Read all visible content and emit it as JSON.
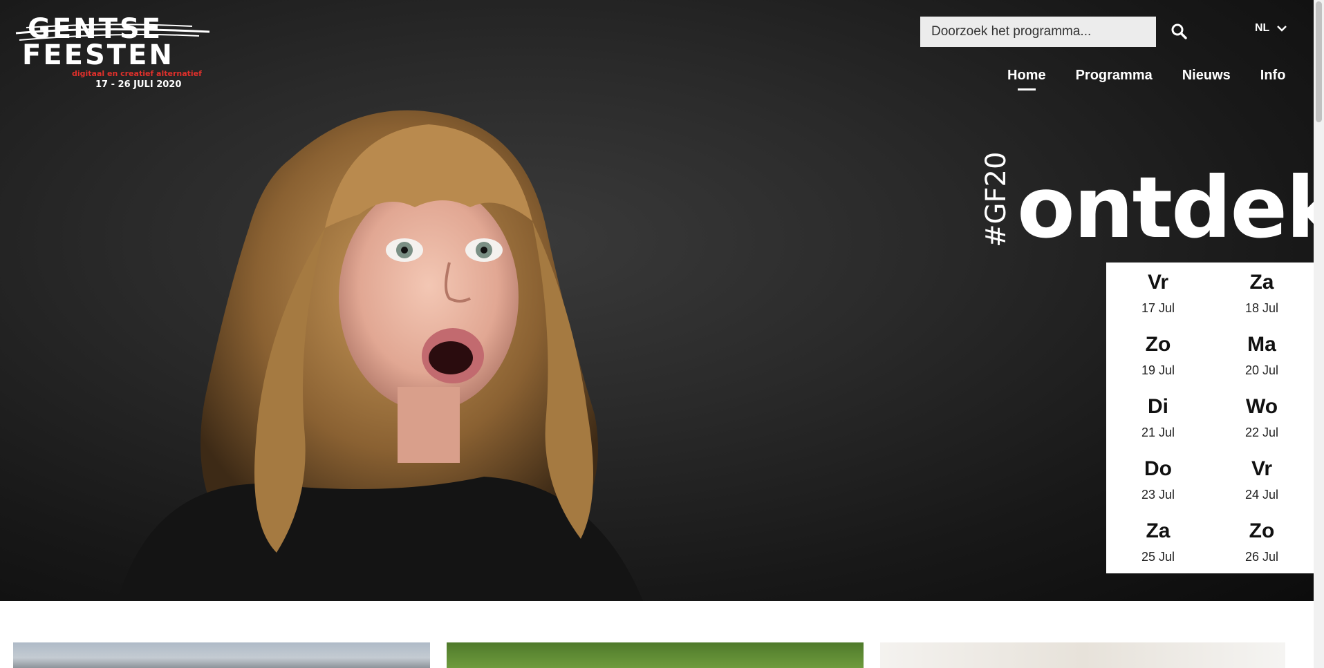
{
  "logo": {
    "line1": "GENTSE",
    "line2": "FEESTEN",
    "tagline": "digitaal en creatief alternatief",
    "dates": "17 - 26 JULI 2020"
  },
  "search": {
    "placeholder": "Doorzoek het programma..."
  },
  "language": {
    "selected": "NL"
  },
  "nav": {
    "items": [
      "Home",
      "Programma",
      "Nieuws",
      "Info"
    ],
    "active": "Home"
  },
  "hero": {
    "hashtag": "#GF20",
    "headline": "ontdek"
  },
  "calendar": [
    {
      "day": "Vr",
      "date": "17 Jul"
    },
    {
      "day": "Za",
      "date": "18 Jul"
    },
    {
      "day": "Zo",
      "date": "19 Jul"
    },
    {
      "day": "Ma",
      "date": "20 Jul"
    },
    {
      "day": "Di",
      "date": "21 Jul"
    },
    {
      "day": "Wo",
      "date": "22 Jul"
    },
    {
      "day": "Do",
      "date": "23 Jul"
    },
    {
      "day": "Vr",
      "date": "24 Jul"
    },
    {
      "day": "Za",
      "date": "25 Jul"
    },
    {
      "day": "Zo",
      "date": "26 Jul"
    }
  ],
  "icons": {
    "search": "search-icon",
    "chevron": "chevron-down-icon"
  }
}
